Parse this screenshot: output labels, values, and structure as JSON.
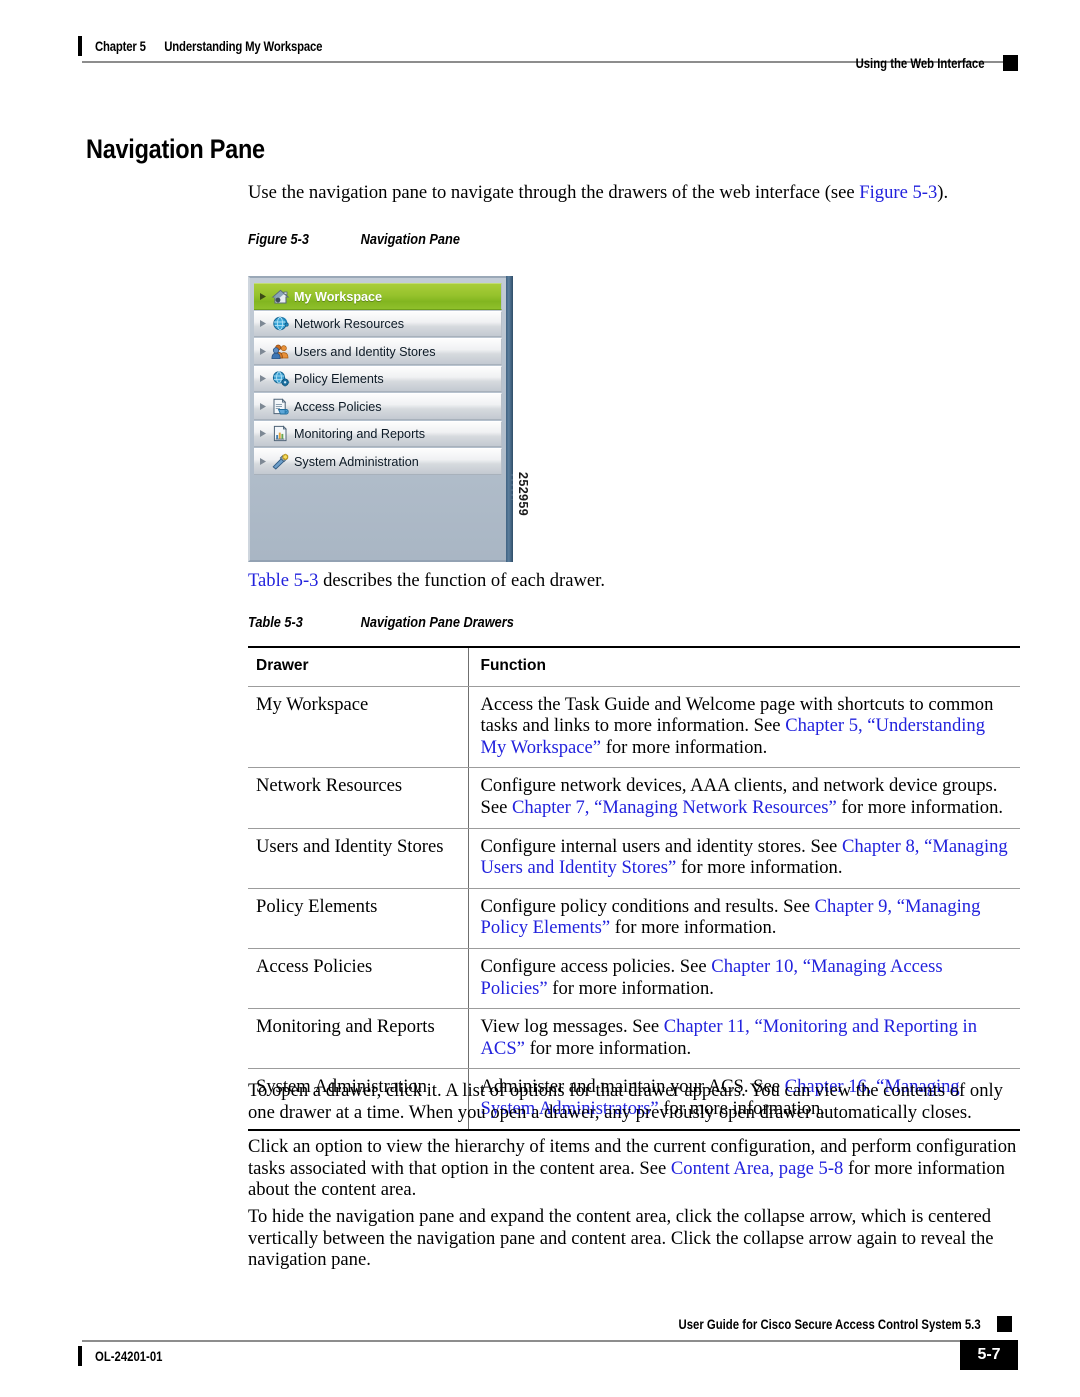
{
  "header": {
    "chapter_number": "Chapter 5",
    "chapter_title": "Understanding My Workspace",
    "right_label": "Using the Web Interface"
  },
  "page": {
    "heading": "Navigation Pane",
    "intro_prefix": "Use the navigation pane to navigate through the drawers of the web interface (see ",
    "intro_link": "Figure 5-3",
    "intro_suffix": ")."
  },
  "figure": {
    "caption_number": "Figure 5-3",
    "caption_title": "Navigation Pane",
    "graphic_id": "252959",
    "items": [
      {
        "label": "My Workspace",
        "icon": "home-icon",
        "selected": true
      },
      {
        "label": "Network Resources",
        "icon": "network-globe-icon",
        "selected": false
      },
      {
        "label": "Users and Identity Stores",
        "icon": "users-icon",
        "selected": false
      },
      {
        "label": "Policy Elements",
        "icon": "policy-gear-globe-icon",
        "selected": false
      },
      {
        "label": "Access Policies",
        "icon": "access-document-icon",
        "selected": false
      },
      {
        "label": "Monitoring and Reports",
        "icon": "bar-chart-report-icon",
        "selected": false
      },
      {
        "label": "System Administration",
        "icon": "tools-admin-icon",
        "selected": false
      }
    ]
  },
  "table_intro": {
    "link": "Table 5-3",
    "rest": " describes the function of each drawer."
  },
  "table": {
    "caption_number": "Table 5-3",
    "caption_title": "Navigation Pane Drawers",
    "columns": [
      "Drawer",
      "Function"
    ],
    "rows": [
      {
        "drawer": "My Workspace",
        "function_parts": [
          {
            "t": "Access the Task Guide and Welcome page with shortcuts to common tasks and links to more information. See ",
            "link": false
          },
          {
            "t": "Chapter 5, “Understanding My Workspace”",
            "link": true
          },
          {
            "t": " for more information.",
            "link": false
          }
        ]
      },
      {
        "drawer": "Network Resources",
        "function_parts": [
          {
            "t": "Configure network devices, AAA clients, and network device groups. See ",
            "link": false
          },
          {
            "t": "Chapter 7, “Managing Network Resources”",
            "link": true
          },
          {
            "t": " for more information.",
            "link": false
          }
        ]
      },
      {
        "drawer": "Users and Identity Stores",
        "function_parts": [
          {
            "t": "Configure internal users and identity stores. See ",
            "link": false
          },
          {
            "t": "Chapter 8, “Managing Users and Identity Stores”",
            "link": true
          },
          {
            "t": " for more information.",
            "link": false
          }
        ]
      },
      {
        "drawer": "Policy Elements",
        "function_parts": [
          {
            "t": "Configure policy conditions and results. See ",
            "link": false
          },
          {
            "t": "Chapter 9, “Managing Policy Elements”",
            "link": true
          },
          {
            "t": " for more information.",
            "link": false
          }
        ]
      },
      {
        "drawer": "Access Policies",
        "function_parts": [
          {
            "t": "Configure access policies. See ",
            "link": false
          },
          {
            "t": "Chapter 10, “Managing Access Policies”",
            "link": true
          },
          {
            "t": " for more information.",
            "link": false
          }
        ]
      },
      {
        "drawer": "Monitoring and Reports",
        "function_parts": [
          {
            "t": "View log messages. See ",
            "link": false
          },
          {
            "t": "Chapter 11, “Monitoring and Reporting in ACS”",
            "link": true
          },
          {
            "t": " for more information.",
            "link": false
          }
        ]
      },
      {
        "drawer": "System Administration",
        "function_parts": [
          {
            "t": "Administer and maintain your ACS. See ",
            "link": false
          },
          {
            "t": "Chapter 16, “Managing System Administrators”",
            "link": true
          },
          {
            "t": " for more information.",
            "link": false
          }
        ]
      }
    ]
  },
  "paragraphs": [
    {
      "parts": [
        {
          "t": "To open a drawer, click it. A list of options for that drawer appears. You can view the contents of only one drawer at a time. When you open a drawer, any previously open drawer automatically closes.",
          "link": false
        }
      ]
    },
    {
      "parts": [
        {
          "t": "Click an option to view the hierarchy of items and the current configuration, and perform configuration tasks associated with that option in the content area. See ",
          "link": false
        },
        {
          "t": "Content Area, page 5-8",
          "link": true
        },
        {
          "t": " for more information about the content area.",
          "link": false
        }
      ]
    },
    {
      "parts": [
        {
          "t": "To hide the navigation pane and expand the content area, click the collapse arrow, which is centered vertically between the navigation pane and content area. Click the collapse arrow again to reveal the navigation pane.",
          "link": false
        }
      ]
    }
  ],
  "footer": {
    "doc_id": "OL-24201-01",
    "guide_title": "User Guide for Cisco Secure Access Control System 5.3",
    "page_number": "5-7"
  },
  "colors": {
    "link": "#2222dd",
    "selected_drawer": "#96c32c",
    "pane_background": "#b3bfcc",
    "pane_edge": "#3f6282"
  }
}
